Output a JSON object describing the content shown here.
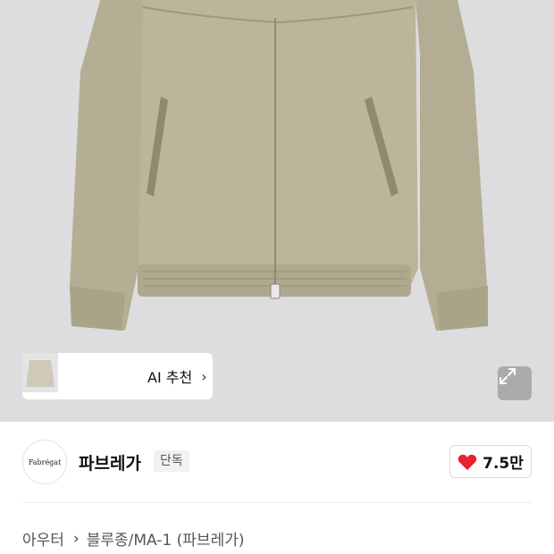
{
  "product_image": {
    "alt_subject": "jacket"
  },
  "ai_recommend": {
    "label": "AI 추천",
    "thumbnails": [
      "thumb-gray-jacket",
      "thumb-tan-jacket",
      "thumb-beige-jacket"
    ]
  },
  "expand": {
    "icon": "expand-icon"
  },
  "brand": {
    "logo_text": "Fabrégat",
    "name": "파브레가",
    "badge": "단독"
  },
  "like": {
    "icon": "heart-icon",
    "count": "7.5만",
    "color": "#e8222e"
  },
  "breadcrumb": {
    "category": "아우터",
    "subcategory": "블루종/MA-1 (파브레가)"
  }
}
